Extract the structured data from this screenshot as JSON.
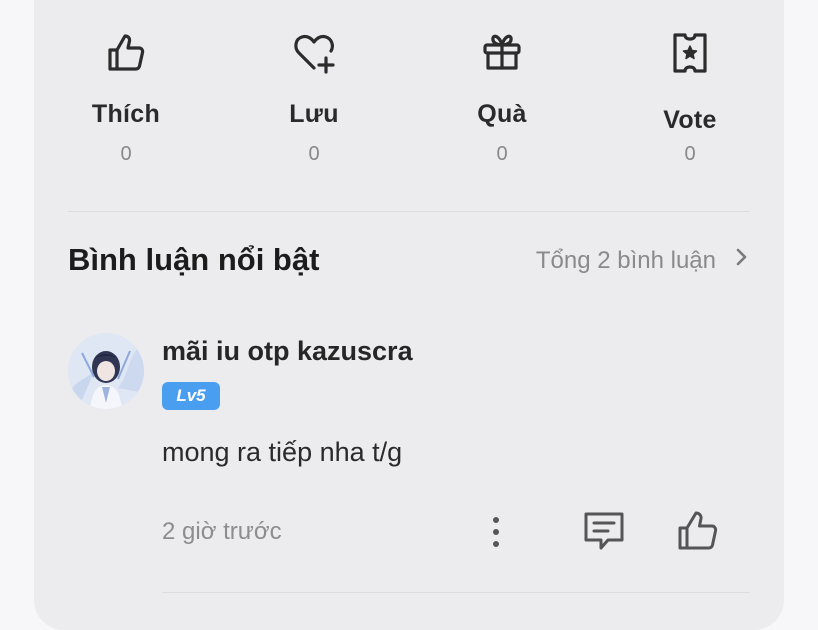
{
  "actions": [
    {
      "label": "Thích",
      "count": "0",
      "icon": "thumbs-up-icon"
    },
    {
      "label": "Lưu",
      "count": "0",
      "icon": "heart-plus-icon"
    },
    {
      "label": "Quà",
      "count": "0",
      "icon": "gift-icon"
    },
    {
      "label": "Vote",
      "count": "0",
      "icon": "vote-ticket-icon"
    }
  ],
  "comments_section": {
    "title": "Bình luận nổi bật",
    "total_link": "Tổng 2 bình luận"
  },
  "comment": {
    "username": "mãi iu otp kazuscra",
    "level": "Lv5",
    "text": "mong ra tiếp nha t/g",
    "time": "2 giờ trước",
    "actions": [
      "more-icon",
      "reply-icon",
      "like-icon"
    ]
  },
  "colors": {
    "card_bg": "#ececee",
    "level_badge": "#4a9ef0",
    "muted_text": "#8d8d8d"
  }
}
